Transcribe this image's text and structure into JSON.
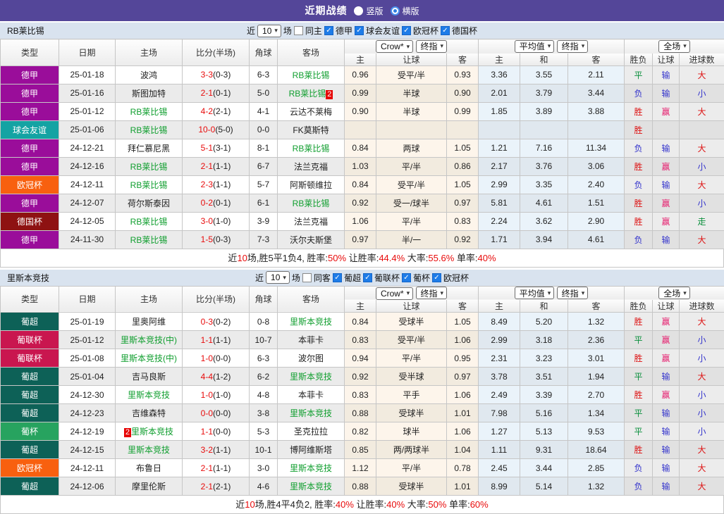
{
  "title_bar": {
    "title": "近期战绩",
    "radios": [
      {
        "label": "竖版",
        "selected": false
      },
      {
        "label": "横版",
        "selected": true
      }
    ]
  },
  "colors": {
    "accent_purple": "#544699",
    "section_bar": "#d9e3ef",
    "highlight_green": "#0f9e2e",
    "score_red": "#e80b0b",
    "badge_red": "#e60000",
    "leagues": {
      "德甲": "#9a0d9a",
      "球会友谊": "#14a3a3",
      "欧冠杯": "#f8600f",
      "德国杯": "#8e1212",
      "葡超": "#0d6157",
      "葡联杯": "#c9164f",
      "葡杯": "#27a35f"
    },
    "result": {
      "r": "#dd1111",
      "g": "#0a8f3c",
      "b": "#3333cc",
      "p": "#e61e6e"
    }
  },
  "table_header": {
    "cols": [
      "类型",
      "日期",
      "主场",
      "比分(半场)",
      "角球",
      "客场"
    ],
    "selects": {
      "crow": "Crow*",
      "final1": "终指",
      "avg": "平均值",
      "final2": "终指",
      "full": "全场"
    },
    "sub": [
      "主",
      "让球",
      "客",
      "主",
      "和",
      "客",
      "胜负",
      "让球",
      "进球数"
    ]
  },
  "sections": [
    {
      "team": "RB莱比锡",
      "filters": {
        "near": "近",
        "count": "10",
        "field": "场",
        "same": "同主",
        "leagues": [
          "德甲",
          "球会友谊",
          "欧冠杯",
          "德国杯"
        ]
      },
      "rows": [
        {
          "lg": "德甲",
          "date": "25-01-18",
          "home": {
            "t": "波鸿"
          },
          "score": "3-3",
          "half": "(0-3)",
          "cor": "6-3",
          "away": {
            "t": "RB莱比锡",
            "hl": true
          },
          "o": [
            "0.96",
            "受平/半",
            "0.93",
            "3.36",
            "3.55",
            "2.11"
          ],
          "res": [
            [
              "平",
              "g"
            ],
            [
              "输",
              "b"
            ],
            [
              "大",
              "r"
            ]
          ]
        },
        {
          "lg": "德甲",
          "date": "25-01-16",
          "home": {
            "t": "斯图加特"
          },
          "score": "2-1",
          "half": "(0-1)",
          "cor": "5-0",
          "away": {
            "t": "RB莱比锡",
            "hl": true,
            "ba": "2"
          },
          "o": [
            "0.99",
            "半球",
            "0.90",
            "2.01",
            "3.79",
            "3.44"
          ],
          "res": [
            [
              "负",
              "b"
            ],
            [
              "输",
              "b"
            ],
            [
              "小",
              "b"
            ]
          ]
        },
        {
          "lg": "德甲",
          "date": "25-01-12",
          "home": {
            "t": "RB莱比锡",
            "hl": true
          },
          "score": "4-2",
          "half": "(2-1)",
          "cor": "4-1",
          "away": {
            "t": "云达不莱梅"
          },
          "o": [
            "0.90",
            "半球",
            "0.99",
            "1.85",
            "3.89",
            "3.88"
          ],
          "res": [
            [
              "胜",
              "r"
            ],
            [
              "赢",
              "p"
            ],
            [
              "大",
              "r"
            ]
          ]
        },
        {
          "lg": "球会友谊",
          "date": "25-01-06",
          "home": {
            "t": "RB莱比锡",
            "hl": true
          },
          "score": "10-0",
          "half": "(5-0)",
          "cor": "0-0",
          "away": {
            "t": "FK莫斯特"
          },
          "o": [
            "",
            "",
            "",
            "",
            "",
            ""
          ],
          "res": [
            [
              "胜",
              "r"
            ],
            [
              "",
              ""
            ],
            [
              "",
              ""
            ]
          ]
        },
        {
          "lg": "德甲",
          "date": "24-12-21",
          "home": {
            "t": "拜仁慕尼黑"
          },
          "score": "5-1",
          "half": "(3-1)",
          "cor": "8-1",
          "away": {
            "t": "RB莱比锡",
            "hl": true
          },
          "o": [
            "0.84",
            "两球",
            "1.05",
            "1.21",
            "7.16",
            "11.34"
          ],
          "res": [
            [
              "负",
              "b"
            ],
            [
              "输",
              "b"
            ],
            [
              "大",
              "r"
            ]
          ]
        },
        {
          "lg": "德甲",
          "date": "24-12-16",
          "home": {
            "t": "RB莱比锡",
            "hl": true
          },
          "score": "2-1",
          "half": "(1-1)",
          "cor": "6-7",
          "away": {
            "t": "法兰克福"
          },
          "o": [
            "1.03",
            "平/半",
            "0.86",
            "2.17",
            "3.76",
            "3.06"
          ],
          "res": [
            [
              "胜",
              "r"
            ],
            [
              "赢",
              "p"
            ],
            [
              "小",
              "b"
            ]
          ]
        },
        {
          "lg": "欧冠杯",
          "date": "24-12-11",
          "home": {
            "t": "RB莱比锡",
            "hl": true
          },
          "score": "2-3",
          "half": "(1-1)",
          "cor": "5-7",
          "away": {
            "t": "阿斯顿维拉"
          },
          "o": [
            "0.84",
            "受平/半",
            "1.05",
            "2.99",
            "3.35",
            "2.40"
          ],
          "res": [
            [
              "负",
              "b"
            ],
            [
              "输",
              "b"
            ],
            [
              "大",
              "r"
            ]
          ]
        },
        {
          "lg": "德甲",
          "date": "24-12-07",
          "home": {
            "t": "荷尔斯泰因"
          },
          "score": "0-2",
          "half": "(0-1)",
          "cor": "6-1",
          "away": {
            "t": "RB莱比锡",
            "hl": true
          },
          "o": [
            "0.92",
            "受一/球半",
            "0.97",
            "5.81",
            "4.61",
            "1.51"
          ],
          "res": [
            [
              "胜",
              "r"
            ],
            [
              "赢",
              "p"
            ],
            [
              "小",
              "b"
            ]
          ]
        },
        {
          "lg": "德国杯",
          "date": "24-12-05",
          "home": {
            "t": "RB莱比锡",
            "hl": true
          },
          "score": "3-0",
          "half": "(1-0)",
          "cor": "3-9",
          "away": {
            "t": "法兰克福"
          },
          "o": [
            "1.06",
            "平/半",
            "0.83",
            "2.24",
            "3.62",
            "2.90"
          ],
          "res": [
            [
              "胜",
              "r"
            ],
            [
              "赢",
              "p"
            ],
            [
              "走",
              "g"
            ]
          ]
        },
        {
          "lg": "德甲",
          "date": "24-11-30",
          "home": {
            "t": "RB莱比锡",
            "hl": true
          },
          "score": "1-5",
          "half": "(0-3)",
          "cor": "7-3",
          "away": {
            "t": "沃尔夫斯堡"
          },
          "o": [
            "0.97",
            "半/一",
            "0.92",
            "1.71",
            "3.94",
            "4.61"
          ],
          "res": [
            [
              "负",
              "b"
            ],
            [
              "输",
              "b"
            ],
            [
              "大",
              "r"
            ]
          ]
        }
      ],
      "summary": [
        [
          "近",
          "k"
        ],
        [
          "10",
          "r"
        ],
        [
          "场,胜5平1负4, 胜率:",
          "k"
        ],
        [
          "50%",
          "r"
        ],
        [
          " 让胜率:",
          "k"
        ],
        [
          "44.4%",
          "r"
        ],
        [
          " 大率:",
          "k"
        ],
        [
          "55.6%",
          "r"
        ],
        [
          " 单率:",
          "k"
        ],
        [
          "40%",
          "r"
        ]
      ]
    },
    {
      "team": "里斯本竞技",
      "filters": {
        "near": "近",
        "count": "10",
        "field": "场",
        "same": "同客",
        "leagues": [
          "葡超",
          "葡联杯",
          "葡杯",
          "欧冠杯"
        ]
      },
      "rows": [
        {
          "lg": "葡超",
          "date": "25-01-19",
          "home": {
            "t": "里奥阿维"
          },
          "score": "0-3",
          "half": "(0-2)",
          "cor": "0-8",
          "away": {
            "t": "里斯本竞技",
            "hl": true
          },
          "o": [
            "0.84",
            "受球半",
            "1.05",
            "8.49",
            "5.20",
            "1.32"
          ],
          "res": [
            [
              "胜",
              "r"
            ],
            [
              "赢",
              "p"
            ],
            [
              "大",
              "r"
            ]
          ]
        },
        {
          "lg": "葡联杯",
          "date": "25-01-12",
          "home": {
            "t": "里斯本竞技(中)",
            "hl": true
          },
          "score": "1-1",
          "half": "(1-1)",
          "cor": "10-7",
          "away": {
            "t": "本菲卡"
          },
          "o": [
            "0.83",
            "受平/半",
            "1.06",
            "2.99",
            "3.18",
            "2.36"
          ],
          "res": [
            [
              "平",
              "g"
            ],
            [
              "赢",
              "p"
            ],
            [
              "小",
              "b"
            ]
          ]
        },
        {
          "lg": "葡联杯",
          "date": "25-01-08",
          "home": {
            "t": "里斯本竞技(中)",
            "hl": true
          },
          "score": "1-0",
          "half": "(0-0)",
          "cor": "6-3",
          "away": {
            "t": "波尔图"
          },
          "o": [
            "0.94",
            "平/半",
            "0.95",
            "2.31",
            "3.23",
            "3.01"
          ],
          "res": [
            [
              "胜",
              "r"
            ],
            [
              "赢",
              "p"
            ],
            [
              "小",
              "b"
            ]
          ]
        },
        {
          "lg": "葡超",
          "date": "25-01-04",
          "home": {
            "t": "吉马良斯"
          },
          "score": "4-4",
          "half": "(1-2)",
          "cor": "6-2",
          "away": {
            "t": "里斯本竞技",
            "hl": true
          },
          "o": [
            "0.92",
            "受半球",
            "0.97",
            "3.78",
            "3.51",
            "1.94"
          ],
          "res": [
            [
              "平",
              "g"
            ],
            [
              "输",
              "b"
            ],
            [
              "大",
              "r"
            ]
          ]
        },
        {
          "lg": "葡超",
          "date": "24-12-30",
          "home": {
            "t": "里斯本竞技",
            "hl": true
          },
          "score": "1-0",
          "half": "(1-0)",
          "cor": "4-8",
          "away": {
            "t": "本菲卡"
          },
          "o": [
            "0.83",
            "平手",
            "1.06",
            "2.49",
            "3.39",
            "2.70"
          ],
          "res": [
            [
              "胜",
              "r"
            ],
            [
              "赢",
              "p"
            ],
            [
              "小",
              "b"
            ]
          ]
        },
        {
          "lg": "葡超",
          "date": "24-12-23",
          "home": {
            "t": "吉维森特"
          },
          "score": "0-0",
          "half": "(0-0)",
          "cor": "3-8",
          "away": {
            "t": "里斯本竞技",
            "hl": true
          },
          "o": [
            "0.88",
            "受球半",
            "1.01",
            "7.98",
            "5.16",
            "1.34"
          ],
          "res": [
            [
              "平",
              "g"
            ],
            [
              "输",
              "b"
            ],
            [
              "小",
              "b"
            ]
          ]
        },
        {
          "lg": "葡杯",
          "date": "24-12-19",
          "home": {
            "t": "里斯本竞技",
            "hl": true,
            "bp": "2"
          },
          "score": "1-1",
          "half": "(0-0)",
          "cor": "5-3",
          "away": {
            "t": "圣克拉拉"
          },
          "o": [
            "0.82",
            "球半",
            "1.06",
            "1.27",
            "5.13",
            "9.53"
          ],
          "res": [
            [
              "平",
              "g"
            ],
            [
              "输",
              "b"
            ],
            [
              "小",
              "b"
            ]
          ]
        },
        {
          "lg": "葡超",
          "date": "24-12-15",
          "home": {
            "t": "里斯本竞技",
            "hl": true
          },
          "score": "3-2",
          "half": "(1-1)",
          "cor": "10-1",
          "away": {
            "t": "博阿维斯塔"
          },
          "o": [
            "0.85",
            "两/两球半",
            "1.04",
            "1.11",
            "9.31",
            "18.64"
          ],
          "res": [
            [
              "胜",
              "r"
            ],
            [
              "输",
              "b"
            ],
            [
              "大",
              "r"
            ]
          ]
        },
        {
          "lg": "欧冠杯",
          "date": "24-12-11",
          "home": {
            "t": "布鲁日"
          },
          "score": "2-1",
          "half": "(1-1)",
          "cor": "3-0",
          "away": {
            "t": "里斯本竞技",
            "hl": true
          },
          "o": [
            "1.12",
            "平/半",
            "0.78",
            "2.45",
            "3.44",
            "2.85"
          ],
          "res": [
            [
              "负",
              "b"
            ],
            [
              "输",
              "b"
            ],
            [
              "大",
              "r"
            ]
          ]
        },
        {
          "lg": "葡超",
          "date": "24-12-06",
          "home": {
            "t": "摩里伦斯"
          },
          "score": "2-1",
          "half": "(2-1)",
          "cor": "4-6",
          "away": {
            "t": "里斯本竞技",
            "hl": true
          },
          "o": [
            "0.88",
            "受球半",
            "1.01",
            "8.99",
            "5.14",
            "1.32"
          ],
          "res": [
            [
              "负",
              "b"
            ],
            [
              "输",
              "b"
            ],
            [
              "大",
              "r"
            ]
          ]
        }
      ],
      "summary": [
        [
          "近",
          "k"
        ],
        [
          "10",
          "r"
        ],
        [
          "场,胜4平4负2, 胜率:",
          "k"
        ],
        [
          "40%",
          "r"
        ],
        [
          " 让胜率:",
          "k"
        ],
        [
          "40%",
          "r"
        ],
        [
          " 大率:",
          "k"
        ],
        [
          "50%",
          "r"
        ],
        [
          " 单率:",
          "k"
        ],
        [
          "60%",
          "r"
        ]
      ]
    }
  ]
}
